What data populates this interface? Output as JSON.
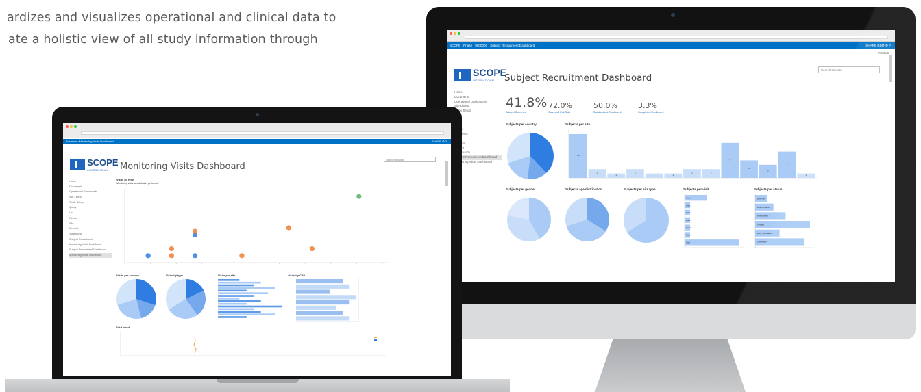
{
  "intro": {
    "line1": "...",
    "line2": "ardizes and visualizes operational and clinical data to",
    "line3": "ate a holistic view of all study information through"
  },
  "colors": {
    "brand_blue": "#1f66c1",
    "suitebar_blue": "#0072c6",
    "chart_blue": "#2f7de0",
    "chart_light": "#a9cbf5",
    "orange_marker": "#f07c2f",
    "green_marker": "#59b36b"
  },
  "monitor": {
    "suitebar_left": "SCOPE · Phase · 0000000 · Subject Recruitment Dashboard",
    "suitebar_right": "SHARE   EDIT   ⚙   ?",
    "top_right": "FOCUS",
    "logo": {
      "title": "SCOPE",
      "subtitle": "INTERNATIONAL"
    },
    "page_title": "Subject Recruitment Dashboard",
    "search_placeholder": "Search this site",
    "sidenav": [
      "Home",
      "Documents",
      "Operational Dashboards",
      "Site Listing",
      "Study Setup",
      "",
      "",
      "",
      "Query",
      "Payments",
      "Site",
      "Reports",
      "Recent",
      "Site Search",
      "Subject Recruitment Dashboard",
      "Monitoring Visits Dashboard"
    ],
    "kpis": [
      {
        "value": "41.8%",
        "label": "Subject Screened"
      },
      {
        "value": "72.0%",
        "label": "Screened Fail Rate"
      },
      {
        "value": "50.0%",
        "label": "Randomized Enrollment"
      },
      {
        "value": "3.3%",
        "label": "Completed Enrollment"
      }
    ],
    "panels": {
      "by_country": "Subjects per country",
      "by_site": "Subjects per site",
      "by_gender": "Subjects per gender",
      "by_age": "Subjects age distribution",
      "by_type": "Subjects per site type",
      "by_visit": "Subjects per visit",
      "by_status": "Subjects per status"
    },
    "site_bar_values": [
      10,
      2,
      1,
      2,
      1,
      1,
      2,
      2,
      8,
      4,
      3,
      6,
      1
    ],
    "visit_bars": [
      {
        "label": "Visit 1",
        "value": 4
      },
      {
        "label": "Visit 2",
        "value": 1
      },
      {
        "label": "Visit 3",
        "value": 1
      },
      {
        "label": "Visit 4",
        "value": 1
      },
      {
        "label": "Visit 5",
        "value": 1
      },
      {
        "label": "Visit 6",
        "value": 1
      },
      {
        "label": "Visit 7",
        "value": 10
      }
    ],
    "status_bars": [
      {
        "label": "Screened",
        "value": 2
      },
      {
        "label": "Screen Failed",
        "value": 3
      },
      {
        "label": "Randomized",
        "value": 5
      },
      {
        "label": "Enrolled",
        "value": 9
      },
      {
        "label": "Early Terminated",
        "value": 4
      },
      {
        "label": "Completed",
        "value": 8
      }
    ]
  },
  "laptop": {
    "suitebar_left": "Business · Monitoring Visits Dashboard",
    "suitebar_right": "SHARE  ⚙  ?",
    "logo": {
      "title": "SCOPE",
      "subtitle": "INTERNATIONAL"
    },
    "page_title": "Monitoring Visits Dashboard",
    "search_placeholder": "Search this site",
    "sidenav": [
      "Home",
      "Documents",
      "Operational Dashboards",
      "Site Listing",
      "Study Setup",
      "Query",
      "List",
      "Recent",
      "Site",
      "Reports",
      "Scheduled",
      "Subject Recruitment",
      "Monitoring Visits Dashboard",
      "Subject Recruitment Dashboard",
      "Monitoring Visits Dashboard"
    ],
    "scatter_title": "Visits by type",
    "scatter_subtitle": "Monitoring visits scheduled vs performed",
    "panels": {
      "by_country": "Visits per country",
      "by_type": "Visits by type",
      "by_site": "Visits per site",
      "by_cra": "Visits by CRA",
      "trend": "Visit trend"
    },
    "scatter_points": [
      {
        "x": 1,
        "y": 1,
        "c": "blue"
      },
      {
        "x": 2,
        "y": 2,
        "c": "orange"
      },
      {
        "x": 2,
        "y": 1,
        "c": "orange"
      },
      {
        "x": 3,
        "y": 1,
        "c": "blue"
      },
      {
        "x": 3,
        "y": 4,
        "c": "blue"
      },
      {
        "x": 3,
        "y": 4.5,
        "c": "orange"
      },
      {
        "x": 5,
        "y": 1,
        "c": "orange"
      },
      {
        "x": 7,
        "y": 5,
        "c": "orange"
      },
      {
        "x": 8,
        "y": 2,
        "c": "orange"
      },
      {
        "x": 10,
        "y": 9.5,
        "c": "green"
      }
    ],
    "site_bars": [
      3,
      6,
      5,
      8,
      4,
      7,
      5,
      3,
      6,
      4,
      9,
      5,
      6,
      8,
      4
    ],
    "cra_rows": [
      7,
      8,
      5,
      9,
      8,
      6,
      7,
      8
    ]
  }
}
